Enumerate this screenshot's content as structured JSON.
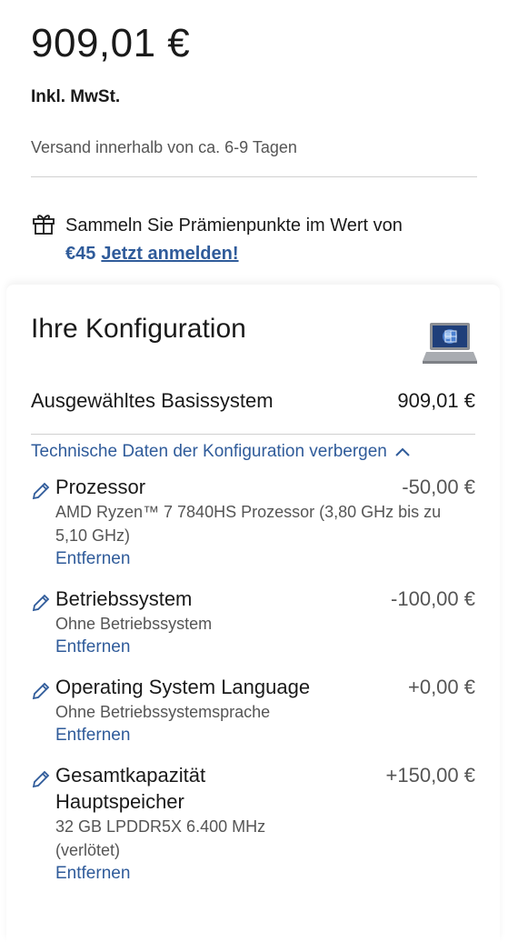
{
  "price": "909,01 €",
  "tax_label": "Inkl. MwSt.",
  "shipping": "Versand innerhalb von ca. 6-9 Tagen",
  "points": {
    "text": "Sammeln Sie Prämienpunkte im Wert von",
    "amount": "€45",
    "link": "Jetzt anmelden!"
  },
  "config": {
    "title": "Ihre Konfiguration",
    "base_label": "Ausgewähltes Basissystem",
    "base_price": "909,01 €",
    "toggle_label": "Technische Daten der Konfiguration verbergen",
    "remove_label": "Entfernen",
    "items": [
      {
        "name": "Prozessor",
        "price": "-50,00 €",
        "desc": "AMD Ryzen™ 7 7840HS Prozessor (3,80 GHz bis zu 5,10 GHz)"
      },
      {
        "name": "Betriebssystem",
        "price": "-100,00 €",
        "desc": "Ohne Betriebssystem"
      },
      {
        "name": "Operating System Language",
        "price": "+0,00 €",
        "desc": "Ohne Betriebssystemsprache"
      },
      {
        "name": "Gesamtkapazität Hauptspeicher",
        "price": "+150,00 €",
        "desc": "32 GB LPDDR5X 6.400 MHz (verlötet)"
      }
    ]
  },
  "icons": {
    "gift": "gift-icon",
    "pencil": "pencil-icon",
    "chevron": "chevron-up-icon",
    "laptop": "laptop-thumbnail"
  },
  "colors": {
    "link": "#2f5b9a",
    "muted": "#555555",
    "divider": "#d0d0d0"
  }
}
